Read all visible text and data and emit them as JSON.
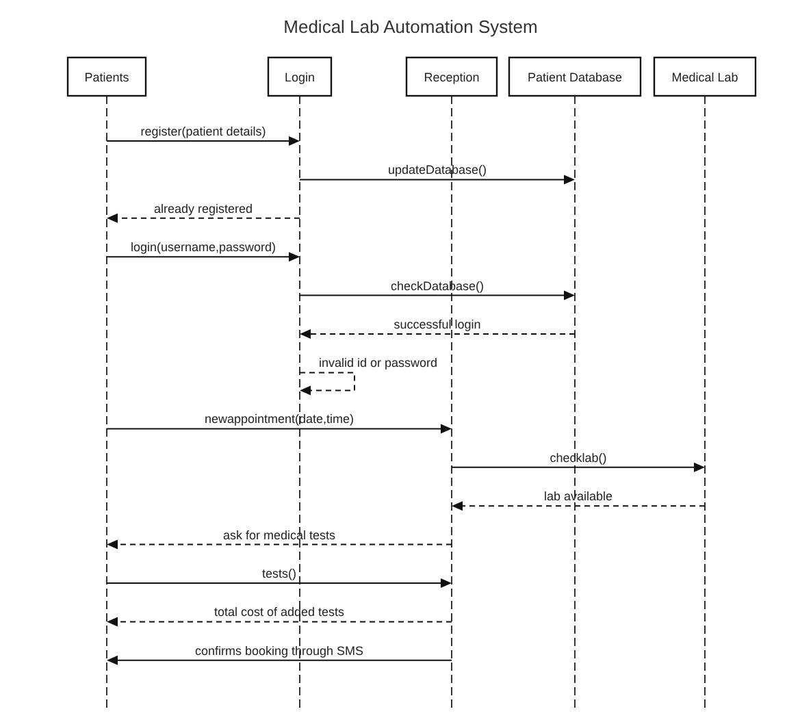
{
  "title": "Medical Lab Automation System",
  "participants": [
    {
      "name": "Patients"
    },
    {
      "name": "Login"
    },
    {
      "name": "Reception"
    },
    {
      "name": "Patient Database"
    },
    {
      "name": "Medical Lab"
    }
  ],
  "messages": [
    {
      "kind": "call",
      "label": "register(patient details)"
    },
    {
      "kind": "call",
      "label": "updateDatabase()"
    },
    {
      "kind": "reply",
      "label": "already registered"
    },
    {
      "kind": "call",
      "label": "login(username,password)"
    },
    {
      "kind": "call",
      "label": "checkDatabase()"
    },
    {
      "kind": "reply",
      "label": "successful login"
    },
    {
      "kind": "self_reply",
      "label": "invalid id or password"
    },
    {
      "kind": "call",
      "label": "newappointment(date,time)"
    },
    {
      "kind": "call",
      "label": "checklab()"
    },
    {
      "kind": "reply",
      "label": "lab available"
    },
    {
      "kind": "reply",
      "label": "ask for medical tests"
    },
    {
      "kind": "call",
      "label": "tests()"
    },
    {
      "kind": "reply",
      "label": "total cost of added tests"
    },
    {
      "kind": "call",
      "label": "confirms booking through SMS"
    }
  ]
}
